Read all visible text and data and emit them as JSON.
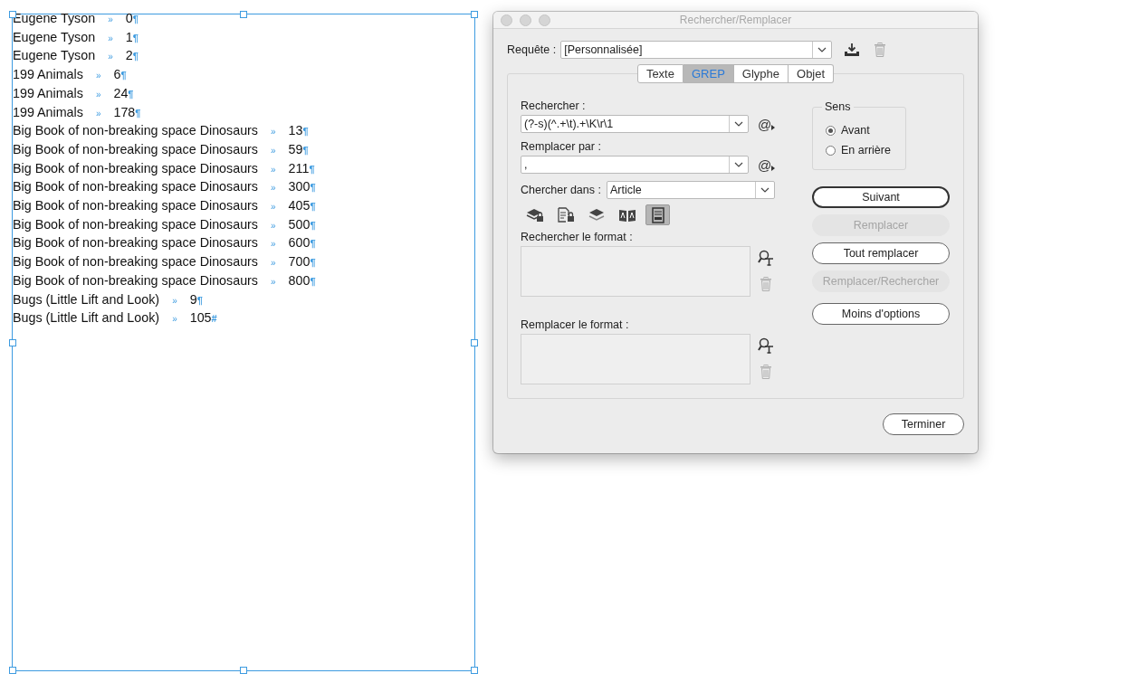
{
  "text_frame": {
    "lines": [
      {
        "name": "Eugene Tyson",
        "tab_mark": "»",
        "number": "0",
        "end_mark": "¶"
      },
      {
        "name": "Eugene Tyson",
        "tab_mark": "»",
        "number": "1",
        "end_mark": "¶"
      },
      {
        "name": "Eugene Tyson",
        "tab_mark": "»",
        "number": "2",
        "end_mark": "¶"
      },
      {
        "name": "199 Animals",
        "tab_mark": "»",
        "number": "6",
        "end_mark": "¶"
      },
      {
        "name": "199 Animals",
        "tab_mark": "»",
        "number": "24",
        "end_mark": "¶"
      },
      {
        "name": "199 Animals",
        "tab_mark": "»",
        "number": "178",
        "end_mark": "¶"
      },
      {
        "name": "Big Book of non-breaking space Dinosaurs",
        "tab_mark": "»",
        "number": "13",
        "end_mark": "¶"
      },
      {
        "name": "Big Book of non-breaking space Dinosaurs",
        "tab_mark": "»",
        "number": "59",
        "end_mark": "¶"
      },
      {
        "name": "Big Book of non-breaking space Dinosaurs",
        "tab_mark": "»",
        "number": "211",
        "end_mark": "¶"
      },
      {
        "name": "Big Book of non-breaking space Dinosaurs",
        "tab_mark": "»",
        "number": "300",
        "end_mark": "¶"
      },
      {
        "name": "Big Book of non-breaking space Dinosaurs",
        "tab_mark": "»",
        "number": "405",
        "end_mark": "¶"
      },
      {
        "name": "Big Book of non-breaking space Dinosaurs",
        "tab_mark": "»",
        "number": "500",
        "end_mark": "¶"
      },
      {
        "name": "Big Book of non-breaking space Dinosaurs",
        "tab_mark": "»",
        "number": "600",
        "end_mark": "¶"
      },
      {
        "name": "Big Book of non-breaking space Dinosaurs",
        "tab_mark": "»",
        "number": "700",
        "end_mark": "¶"
      },
      {
        "name": "Big Book of non-breaking space Dinosaurs",
        "tab_mark": "»",
        "number": "800",
        "end_mark": "¶"
      },
      {
        "name": "Bugs (Little Lift and Look)",
        "tab_mark": "»",
        "number": "9",
        "end_mark": "¶"
      },
      {
        "name": "Bugs (Little Lift and Look)",
        "tab_mark": "»",
        "number": "105",
        "end_mark": "#"
      }
    ]
  },
  "dialog": {
    "title": "Rechercher/Remplacer",
    "query": {
      "label": "Requête :",
      "value": "[Personnalisée]"
    },
    "tabs": [
      {
        "label": "Texte",
        "selected": false
      },
      {
        "label": "GREP",
        "selected": true
      },
      {
        "label": "Glyphe",
        "selected": false
      },
      {
        "label": "Objet",
        "selected": false
      }
    ],
    "find": {
      "label": "Rechercher :",
      "value": "(?-s)(^.+\\t).+\\K\\r\\1",
      "special_char": "@"
    },
    "replace": {
      "label": "Remplacer par :",
      "value": ",",
      "special_char": "@"
    },
    "search_in": {
      "label": "Chercher dans :",
      "value": "Article"
    },
    "options": [
      {
        "kind": "locked-layers",
        "selected": false
      },
      {
        "kind": "locked-stories",
        "selected": false
      },
      {
        "kind": "hidden-layers",
        "selected": false
      },
      {
        "kind": "master-pages",
        "selected": false
      },
      {
        "kind": "footnotes",
        "selected": true
      }
    ],
    "find_format": {
      "label": "Rechercher le format :"
    },
    "replace_format": {
      "label": "Remplacer le format :"
    },
    "direction": {
      "title": "Sens",
      "options": [
        {
          "label": "Avant",
          "selected": true
        },
        {
          "label": "En arrière",
          "selected": false
        }
      ]
    },
    "buttons": [
      {
        "label": "Suivant",
        "default": true,
        "disabled": false
      },
      {
        "label": "Remplacer",
        "default": false,
        "disabled": true
      },
      {
        "label": "Tout remplacer",
        "default": false,
        "disabled": false
      },
      {
        "label": "Remplacer/Rechercher",
        "default": false,
        "disabled": true
      },
      {
        "label": "Moins d'options",
        "default": false,
        "disabled": false
      }
    ],
    "done_button": "Terminer"
  }
}
